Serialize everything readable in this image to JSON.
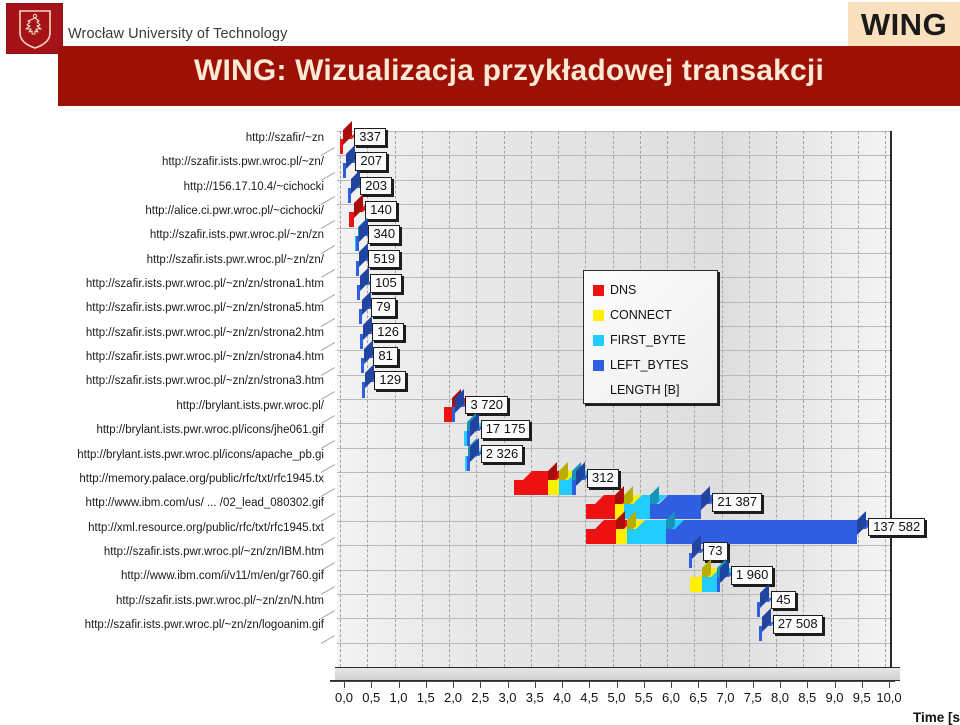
{
  "header": {
    "university": "Wrocław University of Technology",
    "badge": "WING",
    "title": "WING: Wizualizacja przykładowej transakcji",
    "logo_icon": "shield-eagle-icon",
    "brand_red": "#9C1006",
    "badge_bg": "#FAE0BE"
  },
  "chart_data": {
    "type": "bar",
    "orientation": "horizontal-stacked",
    "title": "WING: Wizualizacja przykładowej transakcji",
    "xlabel": "Time [s",
    "ylabel": "",
    "xlim": [
      0,
      10
    ],
    "grid": "horizontal-solid, vertical-dashed",
    "legend_position": "inside-upper-right",
    "xticks": [
      "0,0",
      "0,5",
      "1,0",
      "1,5",
      "2,0",
      "2,5",
      "3,0",
      "3,5",
      "4,0",
      "4,5",
      "5,0",
      "5,5",
      "6,0",
      "6,5",
      "7,0",
      "7,5",
      "8,0",
      "8,5",
      "9,0",
      "9,5",
      "10,0"
    ],
    "legend": [
      {
        "label": "DNS",
        "color": "#EE1111"
      },
      {
        "label": "CONNECT",
        "color": "#FFF000"
      },
      {
        "label": "FIRST_BYTE",
        "color": "#22CCFF"
      },
      {
        "label": "LEFT_BYTES",
        "color": "#2F5FE0"
      },
      {
        "label": "LENGTH [B]",
        "color": ""
      }
    ],
    "categories": [
      "http://szafir/~zn",
      "http://szafir.ists.pwr.wroc.pl/~zn/",
      "http://156.17.10.4/~cichocki",
      "http://alice.ci.pwr.wroc.pl/~cichocki/",
      "http://szafir.ists.pwr.wroc.pl/~zn/zn",
      "http://szafir.ists.pwr.wroc.pl/~zn/zn/",
      "http://szafir.ists.pwr.wroc.pl/~zn/zn/strona1.htm",
      "http://szafir.ists.pwr.wroc.pl/~zn/zn/strona5.htm",
      "http://szafir.ists.pwr.wroc.pl/~zn/zn/strona2.htm",
      "http://szafir.ists.pwr.wroc.pl/~zn/zn/strona4.htm",
      "http://szafir.ists.pwr.wroc.pl/~zn/zn/strona3.htm",
      "http://brylant.ists.pwr.wroc.pl/",
      "http://brylant.ists.pwr.wroc.pl/icons/jhe061.gif",
      "http://brylant.ists.pwr.wroc.pl/icons/apache_pb.gi",
      "http://memory.palace.org/public/rfc/txt/rfc1945.tx",
      "http://www.ibm.com/us/ ... /02_lead_080302.gif",
      "http://xml.resource.org/public/rfc/txt/rfc1945.txt",
      "http://szafir.ists.pwr.wroc.pl/~zn/zn/IBM.htm",
      "http://www.ibm.com/i/v11/m/en/gr760.gif",
      "http://szafir.ists.pwr.wroc.pl/~zn/zn/N.htm",
      "http://szafir.ists.pwr.wroc.pl/~zn/zn/logoanim.gif"
    ],
    "labels": [
      "337",
      "207",
      "203",
      "140",
      "340",
      "519",
      "105",
      "79",
      "126",
      "81",
      "129",
      "3 720",
      "17 175",
      "2 326",
      "312",
      "21 387",
      "137 582",
      "73",
      "1 960",
      "45",
      "27 508"
    ],
    "rows": [
      {
        "label": "337",
        "start": 0.0,
        "dns": 0.06,
        "connect": 0.0,
        "first_byte": 0.0,
        "left_bytes": 0.0
      },
      {
        "label": "207",
        "start": 0.05,
        "dns": 0.0,
        "connect": 0.0,
        "first_byte": 0.0,
        "left_bytes": 0.03
      },
      {
        "label": "203",
        "start": 0.14,
        "dns": 0.0,
        "connect": 0.0,
        "first_byte": 0.0,
        "left_bytes": 0.03
      },
      {
        "label": "140",
        "start": 0.17,
        "dns": 0.09,
        "connect": 0.0,
        "first_byte": 0.0,
        "left_bytes": 0.0
      },
      {
        "label": "340",
        "start": 0.27,
        "dns": 0.0,
        "connect": 0.0,
        "first_byte": 0.02,
        "left_bytes": 0.03
      },
      {
        "label": "519",
        "start": 0.29,
        "dns": 0.0,
        "connect": 0.0,
        "first_byte": 0.0,
        "left_bytes": 0.03
      },
      {
        "label": "105",
        "start": 0.32,
        "dns": 0.0,
        "connect": 0.0,
        "first_byte": 0.0,
        "left_bytes": 0.03
      },
      {
        "label": "79",
        "start": 0.34,
        "dns": 0.0,
        "connect": 0.0,
        "first_byte": 0.0,
        "left_bytes": 0.03
      },
      {
        "label": "126",
        "start": 0.36,
        "dns": 0.0,
        "connect": 0.0,
        "first_byte": 0.0,
        "left_bytes": 0.03
      },
      {
        "label": "81",
        "start": 0.38,
        "dns": 0.0,
        "connect": 0.0,
        "first_byte": 0.0,
        "left_bytes": 0.03
      },
      {
        "label": "129",
        "start": 0.4,
        "dns": 0.0,
        "connect": 0.0,
        "first_byte": 0.0,
        "left_bytes": 0.03
      },
      {
        "label": "3 720",
        "start": 1.9,
        "dns": 0.15,
        "connect": 0.0,
        "first_byte": 0.0,
        "left_bytes": 0.05
      },
      {
        "label": "17 175",
        "start": 2.28,
        "dns": 0.0,
        "connect": 0.0,
        "first_byte": 0.05,
        "left_bytes": 0.05
      },
      {
        "label": "2 326",
        "start": 2.3,
        "dns": 0.0,
        "connect": 0.0,
        "first_byte": 0.03,
        "left_bytes": 0.05
      },
      {
        "label": "312",
        "start": 3.2,
        "dns": 0.62,
        "connect": 0.2,
        "first_byte": 0.23,
        "left_bytes": 0.08
      },
      {
        "label": "21 387",
        "start": 4.52,
        "dns": 0.52,
        "connect": 0.18,
        "first_byte": 0.46,
        "left_bytes": 0.95
      },
      {
        "label": "137 582",
        "start": 4.52,
        "dns": 0.54,
        "connect": 0.2,
        "first_byte": 0.73,
        "left_bytes": 3.5
      },
      {
        "label": "73",
        "start": 6.4,
        "dns": 0.0,
        "connect": 0.0,
        "first_byte": 0.0,
        "left_bytes": 0.06
      },
      {
        "label": "1 960",
        "start": 6.42,
        "dns": 0.0,
        "connect": 0.22,
        "first_byte": 0.28,
        "left_bytes": 0.05
      },
      {
        "label": "45",
        "start": 7.65,
        "dns": 0.0,
        "connect": 0.0,
        "first_byte": 0.0,
        "left_bytes": 0.06
      },
      {
        "label": "27 508",
        "start": 7.68,
        "dns": 0.0,
        "connect": 0.0,
        "first_byte": 0.0,
        "left_bytes": 0.06
      }
    ]
  }
}
